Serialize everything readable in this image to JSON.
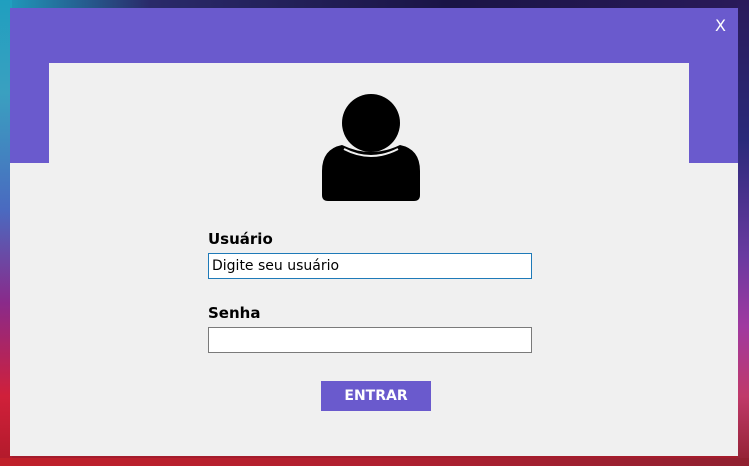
{
  "window": {
    "close_label": "X",
    "accent_color": "#6a5acd",
    "background_color": "#f0f0f0"
  },
  "icons": {
    "avatar": "user-icon"
  },
  "form": {
    "username_label": "Usuário",
    "username_value": "Digite seu usuário",
    "password_label": "Senha",
    "password_value": "",
    "submit_label": "ENTRAR"
  }
}
